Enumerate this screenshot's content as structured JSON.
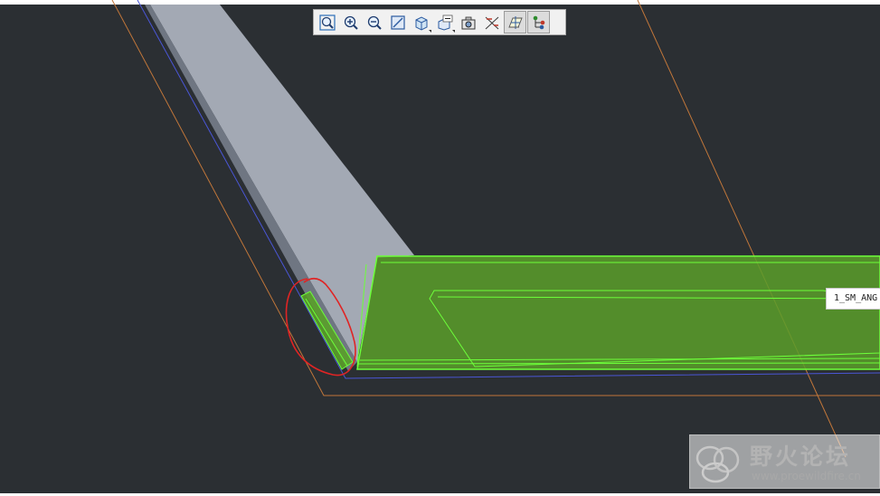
{
  "colors": {
    "background": "#2b2f33",
    "frame": "#ffffff",
    "part_top": "#a3a9b4",
    "part_side": "#6f7682",
    "highlight_fill": "#5a9e2a",
    "highlight_edge": "#6dff3a",
    "datum_orange": "#c0763a",
    "datum_blue": "#4a56d6",
    "annotation_circle": "#e02424"
  },
  "toolbar": {
    "items": [
      {
        "name": "refit",
        "icon": "zoom-fit-icon"
      },
      {
        "name": "zoom_in",
        "icon": "zoom-in-icon"
      },
      {
        "name": "zoom_out",
        "icon": "zoom-out-icon"
      },
      {
        "name": "repaint",
        "icon": "repaint-icon"
      },
      {
        "name": "display_style",
        "icon": "cube-icon",
        "dropdown": true
      },
      {
        "name": "annotation_display",
        "icon": "annotation-icon",
        "dropdown": true
      },
      {
        "name": "saved_views",
        "icon": "camera-icon"
      },
      {
        "name": "datum_planes",
        "icon": "datum-axes-icon"
      },
      {
        "name": "spin_center",
        "icon": "spin-center-icon",
        "active": true
      },
      {
        "name": "model_tree",
        "icon": "tree-icon",
        "active": true
      }
    ]
  },
  "tag": {
    "label": "1_SM_ANG"
  },
  "watermark": {
    "title": "野火论坛",
    "url": "www.proewildfire.cn"
  }
}
